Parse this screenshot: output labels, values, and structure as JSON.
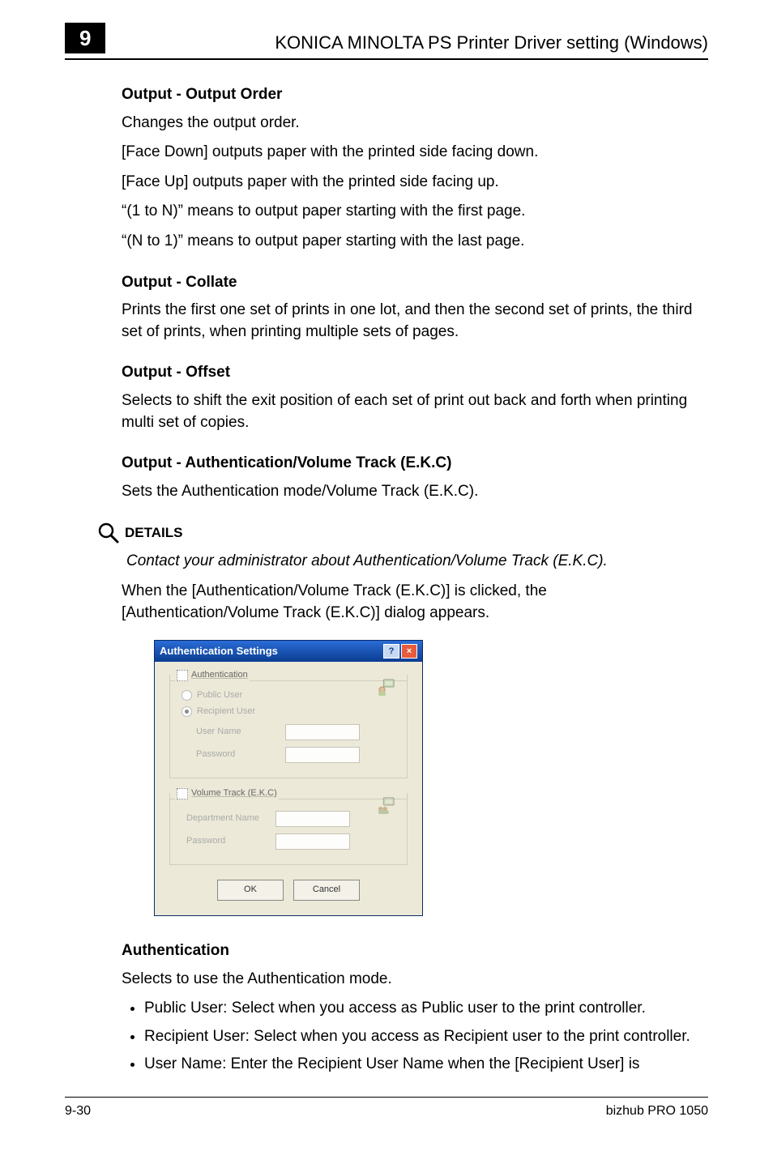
{
  "header": {
    "chapter": "9",
    "title": "KONICA MINOLTA PS Printer Driver setting (Windows)"
  },
  "sections": {
    "outputOrder": {
      "title": "Output - Output Order",
      "p1": "Changes the output order.",
      "p2": "[Face Down] outputs paper with the printed side facing down.",
      "p3": "[Face Up] outputs paper with the printed side facing up.",
      "p4": "“(1 to N)” means to output paper starting with the first page.",
      "p5": "“(N to 1)” means to output paper starting with the last page."
    },
    "collate": {
      "title": "Output - Collate",
      "p1": "Prints the first one set of prints in one lot, and then the second set of prints, the third set of prints, when printing multiple sets of pages."
    },
    "offset": {
      "title": "Output - Offset",
      "p1": "Selects to shift the exit position of each set of print out back and forth when printing multi set of copies."
    },
    "auth": {
      "title": "Output - Authentication/Volume Track (E.K.C)",
      "p1": "Sets the Authentication mode/Volume Track (E.K.C)."
    },
    "details": {
      "label": "DETAILS",
      "italic": "Contact your administrator about Authentication/Volume Track (E.K.C).",
      "p1": "When the [Authentication/Volume Track (E.K.C)] is clicked, the [Authentication/Volume Track (E.K.C)] dialog appears."
    },
    "authentication": {
      "title": "Authentication",
      "p1": "Selects to use the Authentication mode.",
      "b1": "Public User: Select when you access as Public user to the print controller.",
      "b2": "Recipient User: Select when you access as Recipient user to the print controller.",
      "b3": "User Name: Enter the Recipient User Name when the [Recipient User] is"
    }
  },
  "dialog": {
    "title": "Authentication Settings",
    "help": "?",
    "close": "×",
    "group1": {
      "legend": "Authentication",
      "radio1": "Public User",
      "radio2": "Recipient User",
      "field1": "User Name",
      "field2": "Password"
    },
    "group2": {
      "legend": "Volume Track (E.K.C)",
      "field1": "Department Name",
      "field2": "Password"
    },
    "ok": "OK",
    "cancel": "Cancel"
  },
  "footer": {
    "left": "9-30",
    "right": "bizhub PRO 1050"
  }
}
